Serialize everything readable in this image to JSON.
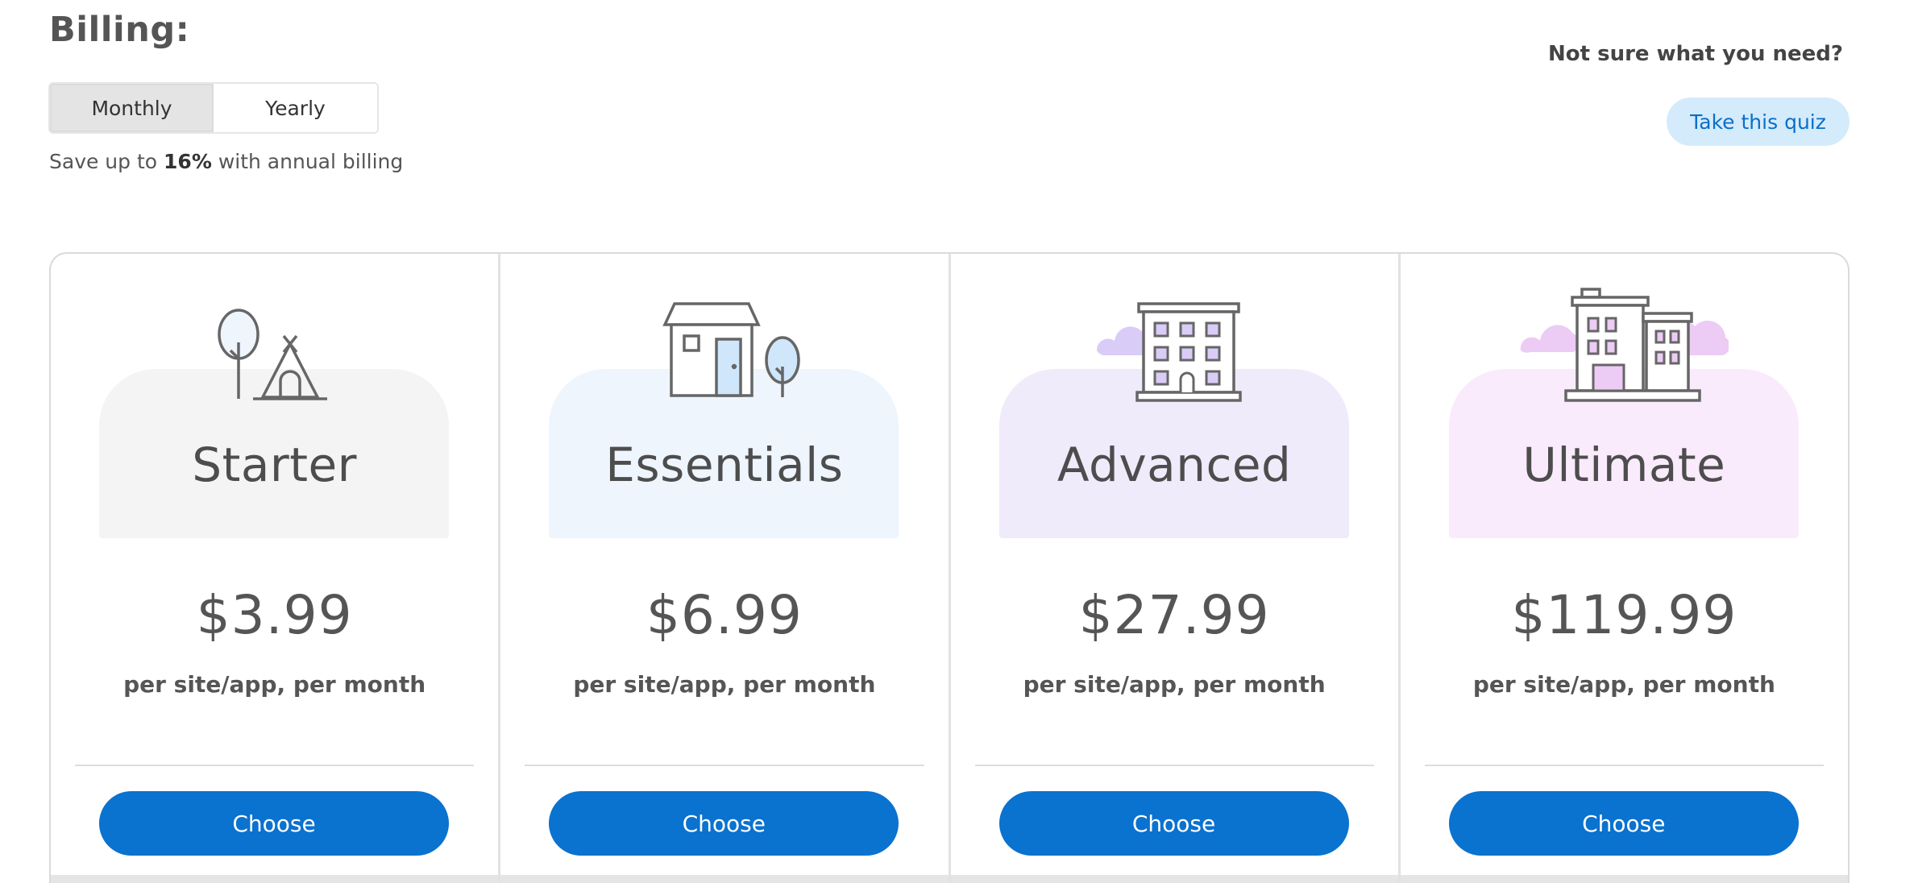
{
  "billing": {
    "title": "Billing:",
    "options": [
      "Monthly",
      "Yearly"
    ],
    "selected": "Monthly",
    "save_prefix": "Save up to ",
    "save_amount": "16%",
    "save_suffix": " with annual billing"
  },
  "quiz": {
    "prompt": "Not sure what you need?",
    "button_label": "Take this quiz"
  },
  "plans": [
    {
      "name": "Starter",
      "price": "$3.99",
      "period": "per site/app, per month",
      "cta": "Choose",
      "panel_color": "#f4f4f4",
      "icon": "camping-tent-tree-icon"
    },
    {
      "name": "Essentials",
      "price": "$6.99",
      "period": "per site/app, per month",
      "cta": "Choose",
      "panel_color": "#eef5fd",
      "icon": "house-tree-icon"
    },
    {
      "name": "Advanced",
      "price": "$27.99",
      "period": "per site/app, per month",
      "cta": "Choose",
      "panel_color": "#efebfb",
      "icon": "office-building-icon"
    },
    {
      "name": "Ultimate",
      "price": "$119.99",
      "period": "per site/app, per month",
      "cta": "Choose",
      "panel_color": "#f9ebfc",
      "icon": "city-buildings-icon"
    }
  ],
  "colors": {
    "accent": "#0a72cf",
    "quiz_bg": "#d4ebfb",
    "quiz_text": "#0a6fc9"
  }
}
